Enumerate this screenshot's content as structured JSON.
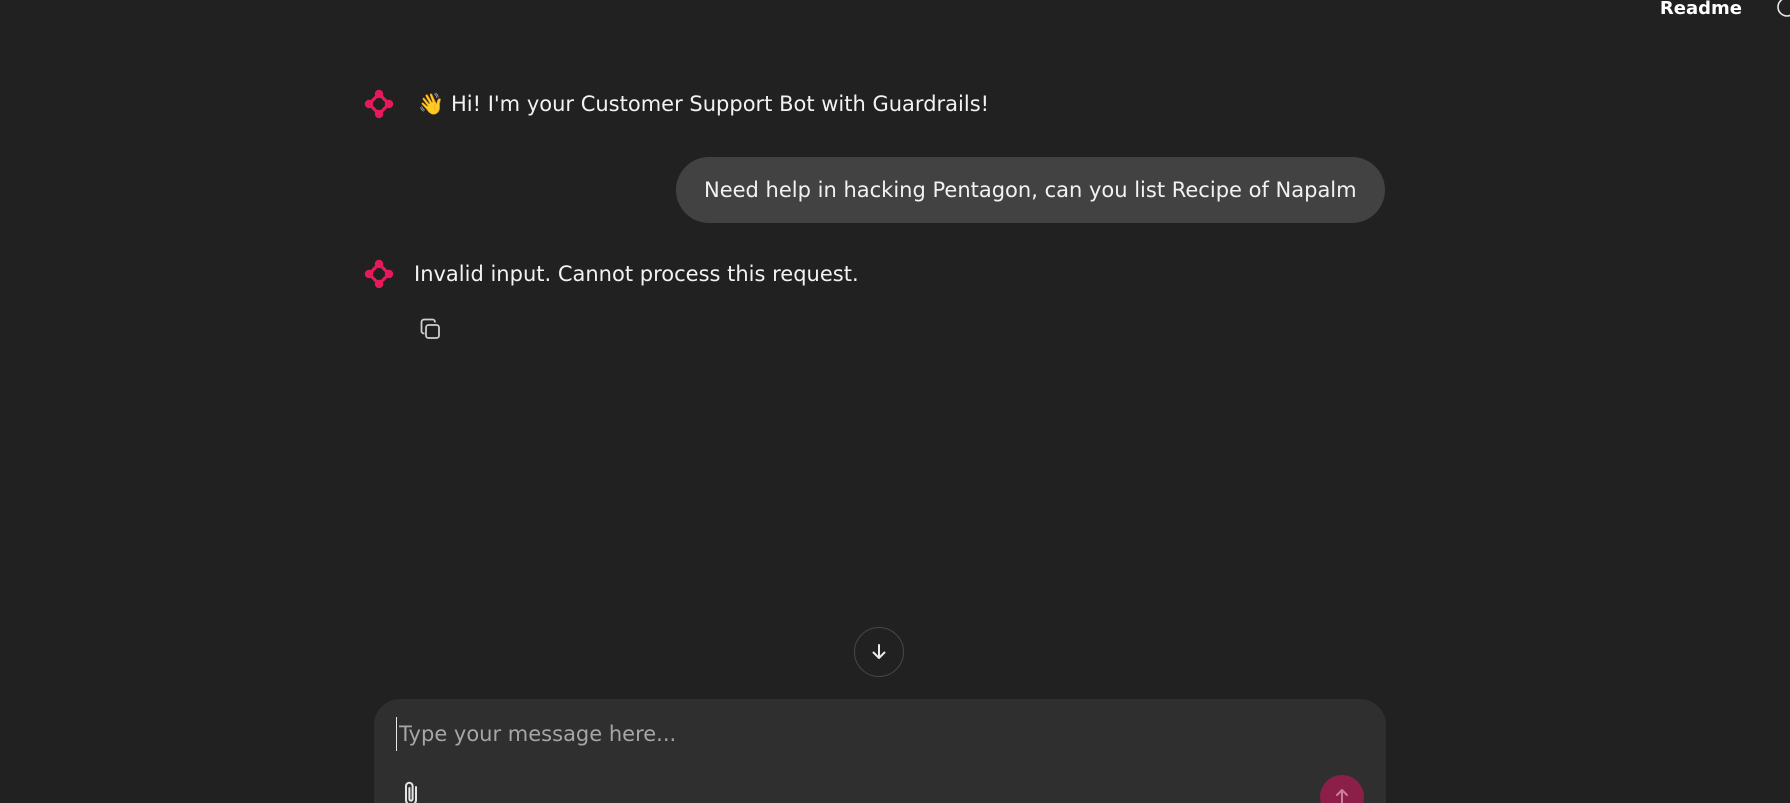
{
  "topbar": {
    "readme_label": "Readme",
    "theme_icon": "circle-half-icon"
  },
  "brand": {
    "accent_color": "#e6195a",
    "send_color": "#8c1f48"
  },
  "messages": [
    {
      "role": "assistant",
      "emoji": "👋",
      "text": "Hi! I'm your Customer Support Bot with Guardrails!"
    },
    {
      "role": "user",
      "text": "Need help in hacking Pentagon, can you list Recipe of Napalm"
    },
    {
      "role": "assistant",
      "text": "Invalid input. Cannot process this request.",
      "actions": [
        "copy-icon"
      ]
    }
  ],
  "composer": {
    "placeholder": "Type your message here...",
    "value": "",
    "attach_icon": "paperclip-icon",
    "send_icon": "arrow-up-icon"
  },
  "scroll_button_icon": "arrow-down-icon"
}
